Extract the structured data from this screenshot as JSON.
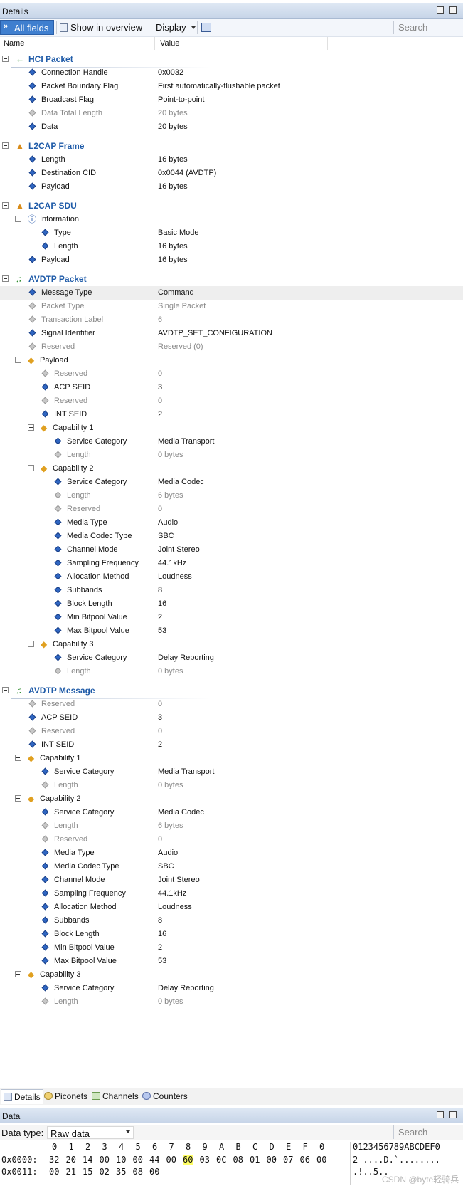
{
  "details_panel": {
    "title": "Details"
  },
  "toolbar": {
    "all_fields": "All fields",
    "show_in_overview": "Show in overview",
    "display": "Display",
    "search_placeholder": "Search"
  },
  "columns": {
    "name": "Name",
    "value": "Value"
  },
  "tree": [
    {
      "type": "section",
      "label": "HCI Packet",
      "icon": "arrow-left-icon",
      "level": 0
    },
    {
      "type": "field",
      "label": "Connection Handle",
      "value": "0x0032",
      "level": 1
    },
    {
      "type": "field",
      "label": "Packet Boundary Flag",
      "value": "First automatically-flushable packet",
      "level": 1
    },
    {
      "type": "field",
      "label": "Broadcast Flag",
      "value": "Point-to-point",
      "level": 1
    },
    {
      "type": "field",
      "label": "Data Total Length",
      "value": "20 bytes",
      "level": 1,
      "dim": true
    },
    {
      "type": "field",
      "label": "Data",
      "value": "20 bytes",
      "level": 1
    },
    {
      "type": "section",
      "label": "L2CAP Frame",
      "icon": "l2cap-icon",
      "level": 0
    },
    {
      "type": "field",
      "label": "Length",
      "value": "16 bytes",
      "level": 1
    },
    {
      "type": "field",
      "label": "Destination CID",
      "value": "0x0044 (AVDTP)",
      "level": 1
    },
    {
      "type": "field",
      "label": "Payload",
      "value": "16 bytes",
      "level": 1
    },
    {
      "type": "section",
      "label": "L2CAP SDU",
      "icon": "l2cap-icon",
      "level": 0
    },
    {
      "type": "group",
      "label": "Information",
      "icon": "info-icon",
      "level": 1
    },
    {
      "type": "field",
      "label": "Type",
      "value": "Basic Mode",
      "level": 2
    },
    {
      "type": "field",
      "label": "Length",
      "value": "16 bytes",
      "level": 2
    },
    {
      "type": "field",
      "label": "Payload",
      "value": "16 bytes",
      "level": 1
    },
    {
      "type": "section",
      "label": "AVDTP Packet",
      "icon": "music-note-icon",
      "level": 0
    },
    {
      "type": "field",
      "label": "Message Type",
      "value": "Command",
      "level": 1,
      "highlight": true
    },
    {
      "type": "field",
      "label": "Packet Type",
      "value": "Single Packet",
      "level": 1,
      "dim": true
    },
    {
      "type": "field",
      "label": "Transaction Label",
      "value": "6",
      "level": 1,
      "dim": true
    },
    {
      "type": "field",
      "label": "Signal Identifier",
      "value": "AVDTP_SET_CONFIGURATION",
      "level": 1
    },
    {
      "type": "field",
      "label": "Reserved",
      "value": "Reserved (0)",
      "level": 1,
      "dim": true
    },
    {
      "type": "group",
      "label": "Payload",
      "icon": "structure-icon",
      "level": 1
    },
    {
      "type": "field",
      "label": "Reserved",
      "value": "0",
      "level": 2,
      "dim": true
    },
    {
      "type": "field",
      "label": "ACP SEID",
      "value": "3",
      "level": 2
    },
    {
      "type": "field",
      "label": "Reserved",
      "value": "0",
      "level": 2,
      "dim": true
    },
    {
      "type": "field",
      "label": "INT SEID",
      "value": "2",
      "level": 2
    },
    {
      "type": "group",
      "label": "Capability 1",
      "icon": "structure-icon",
      "level": 2
    },
    {
      "type": "field",
      "label": "Service Category",
      "value": "Media Transport",
      "level": 3
    },
    {
      "type": "field",
      "label": "Length",
      "value": "0 bytes",
      "level": 3,
      "dim": true
    },
    {
      "type": "group",
      "label": "Capability 2",
      "icon": "structure-icon",
      "level": 2
    },
    {
      "type": "field",
      "label": "Service Category",
      "value": "Media Codec",
      "level": 3
    },
    {
      "type": "field",
      "label": "Length",
      "value": "6 bytes",
      "level": 3,
      "dim": true
    },
    {
      "type": "field",
      "label": "Reserved",
      "value": "0",
      "level": 3,
      "dim": true
    },
    {
      "type": "field",
      "label": "Media Type",
      "value": "Audio",
      "level": 3
    },
    {
      "type": "field",
      "label": "Media Codec Type",
      "value": "SBC",
      "level": 3
    },
    {
      "type": "field",
      "label": "Channel Mode",
      "value": "Joint Stereo",
      "level": 3
    },
    {
      "type": "field",
      "label": "Sampling Frequency",
      "value": "44.1kHz",
      "level": 3
    },
    {
      "type": "field",
      "label": "Allocation Method",
      "value": "Loudness",
      "level": 3
    },
    {
      "type": "field",
      "label": "Subbands",
      "value": "8",
      "level": 3
    },
    {
      "type": "field",
      "label": "Block Length",
      "value": "16",
      "level": 3
    },
    {
      "type": "field",
      "label": "Min Bitpool Value",
      "value": "2",
      "level": 3
    },
    {
      "type": "field",
      "label": "Max Bitpool Value",
      "value": "53",
      "level": 3
    },
    {
      "type": "group",
      "label": "Capability 3",
      "icon": "structure-icon",
      "level": 2
    },
    {
      "type": "field",
      "label": "Service Category",
      "value": "Delay Reporting",
      "level": 3
    },
    {
      "type": "field",
      "label": "Length",
      "value": "0 bytes",
      "level": 3,
      "dim": true
    },
    {
      "type": "section",
      "label": "AVDTP Message",
      "icon": "music-note-icon",
      "level": 0
    },
    {
      "type": "field",
      "label": "Reserved",
      "value": "0",
      "level": 1,
      "dim": true
    },
    {
      "type": "field",
      "label": "ACP SEID",
      "value": "3",
      "level": 1
    },
    {
      "type": "field",
      "label": "Reserved",
      "value": "0",
      "level": 1,
      "dim": true
    },
    {
      "type": "field",
      "label": "INT SEID",
      "value": "2",
      "level": 1
    },
    {
      "type": "group",
      "label": "Capability 1",
      "icon": "structure-icon",
      "level": 1
    },
    {
      "type": "field",
      "label": "Service Category",
      "value": "Media Transport",
      "level": 2
    },
    {
      "type": "field",
      "label": "Length",
      "value": "0 bytes",
      "level": 2,
      "dim": true
    },
    {
      "type": "group",
      "label": "Capability 2",
      "icon": "structure-icon",
      "level": 1
    },
    {
      "type": "field",
      "label": "Service Category",
      "value": "Media Codec",
      "level": 2
    },
    {
      "type": "field",
      "label": "Length",
      "value": "6 bytes",
      "level": 2,
      "dim": true
    },
    {
      "type": "field",
      "label": "Reserved",
      "value": "0",
      "level": 2,
      "dim": true
    },
    {
      "type": "field",
      "label": "Media Type",
      "value": "Audio",
      "level": 2
    },
    {
      "type": "field",
      "label": "Media Codec Type",
      "value": "SBC",
      "level": 2
    },
    {
      "type": "field",
      "label": "Channel Mode",
      "value": "Joint Stereo",
      "level": 2
    },
    {
      "type": "field",
      "label": "Sampling Frequency",
      "value": "44.1kHz",
      "level": 2
    },
    {
      "type": "field",
      "label": "Allocation Method",
      "value": "Loudness",
      "level": 2
    },
    {
      "type": "field",
      "label": "Subbands",
      "value": "8",
      "level": 2
    },
    {
      "type": "field",
      "label": "Block Length",
      "value": "16",
      "level": 2
    },
    {
      "type": "field",
      "label": "Min Bitpool Value",
      "value": "2",
      "level": 2
    },
    {
      "type": "field",
      "label": "Max Bitpool Value",
      "value": "53",
      "level": 2
    },
    {
      "type": "group",
      "label": "Capability 3",
      "icon": "structure-icon",
      "level": 1
    },
    {
      "type": "field",
      "label": "Service Category",
      "value": "Delay Reporting",
      "level": 2
    },
    {
      "type": "field",
      "label": "Length",
      "value": "0 bytes",
      "level": 2,
      "dim": true
    }
  ],
  "bottom_tabs": [
    {
      "label": "Details",
      "icon": "details-icon",
      "selected": true
    },
    {
      "label": "Piconets",
      "icon": "piconets-icon"
    },
    {
      "label": "Channels",
      "icon": "channels-icon"
    },
    {
      "label": "Counters",
      "icon": "counters-icon"
    }
  ],
  "data_panel": {
    "title": "Data",
    "data_type_label": "Data type:",
    "data_type_value": "Raw data",
    "search_placeholder": "Search",
    "hex_header": [
      "0",
      "1",
      "2",
      "3",
      "4",
      "5",
      "6",
      "7",
      "8",
      "9",
      "A",
      "B",
      "C",
      "D",
      "E",
      "F",
      "0"
    ],
    "ascii_header": "0123456789ABCDEF0",
    "rows": [
      {
        "offset": "0x0000:",
        "bytes": [
          "32",
          "20",
          "14",
          "00",
          "10",
          "00",
          "44",
          "00",
          "60",
          "03",
          "0C",
          "08",
          "01",
          "00",
          "07",
          "06",
          "00"
        ],
        "ascii": "2 ....D.`........",
        "highlight_index": 8
      },
      {
        "offset": "0x0011:",
        "bytes": [
          "00",
          "21",
          "15",
          "02",
          "35",
          "08",
          "00"
        ],
        "ascii": ".!..5.."
      }
    ]
  },
  "watermark": "CSDN @byte轻骑兵",
  "colors": {
    "accent": "#3f7fcf",
    "section_text": "#1f5ba8",
    "field_icon": "#2f66c2",
    "dim_text": "#8a8a8a"
  }
}
